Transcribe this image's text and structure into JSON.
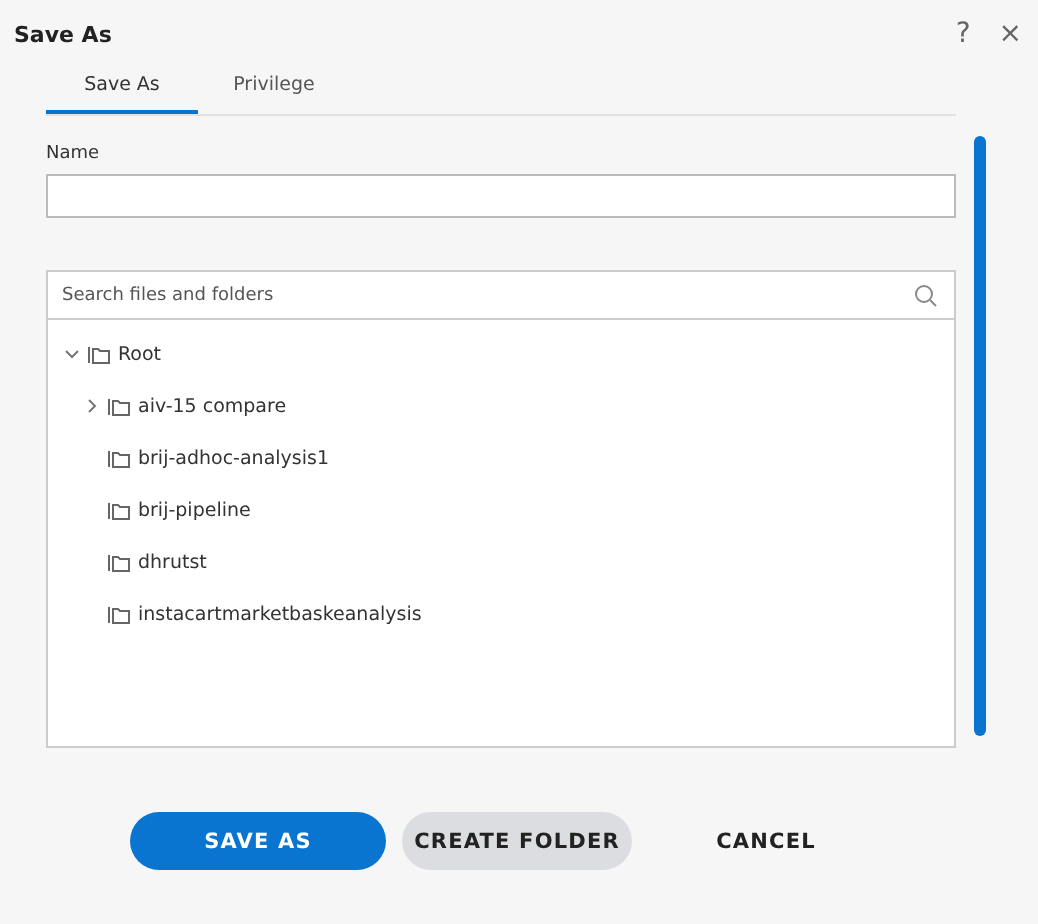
{
  "window": {
    "title": "Save As",
    "help": "?",
    "close": "×"
  },
  "tabs": [
    {
      "label": "Save As",
      "selected": true
    },
    {
      "label": "Privilege",
      "selected": false
    }
  ],
  "name_field": {
    "label": "Name"
  },
  "search": {
    "placeholder": "Search files and folders"
  },
  "tree": [
    {
      "label": "Root",
      "expanded": true,
      "children": [
        {
          "label": "aiv-15 compare",
          "expanded": false
        },
        {
          "label": "brij-adhoc-analysis1"
        },
        {
          "label": "brij-pipeline"
        },
        {
          "label": "dhrutst"
        },
        {
          "label": "instacartmarketbaskeanalysis"
        }
      ]
    }
  ],
  "buttons": [
    {
      "label": "SAVE AS",
      "kind": "primary"
    },
    {
      "label": "CREATE FOLDER",
      "kind": "secondary"
    },
    {
      "label": "CANCEL",
      "kind": "plain"
    }
  ]
}
